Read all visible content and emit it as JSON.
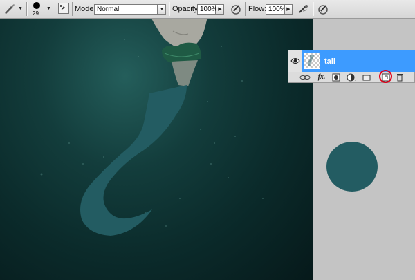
{
  "options_bar": {
    "brush_size": "29",
    "mode_label": "Mode:",
    "mode_value": "Normal",
    "opacity_label": "Opacity:",
    "opacity_value": "100%",
    "flow_label": "Flow:",
    "flow_value": "100%"
  },
  "layers_panel": {
    "layer_name": "tail",
    "icons": [
      "link-icon",
      "fx-icon",
      "mask-icon",
      "adjustment-icon",
      "group-folder-icon",
      "new-layer-icon",
      "trash-icon"
    ],
    "fx_label": "fx."
  },
  "colors": {
    "selection_blue": "#3d9bff",
    "shape_teal": "#235c62",
    "highlight_red": "#e0001a"
  }
}
